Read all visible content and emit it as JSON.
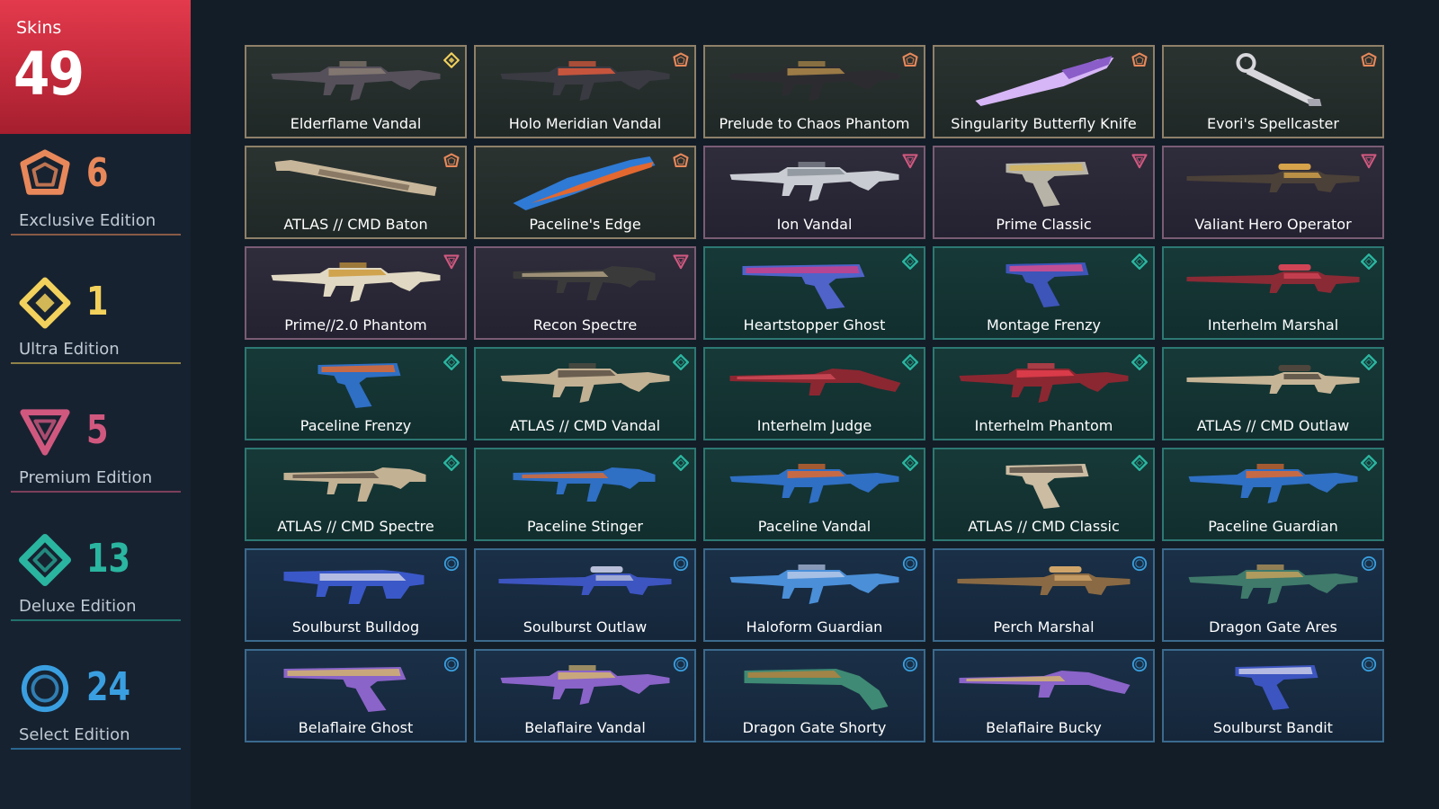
{
  "summary": {
    "label": "Skins",
    "count": "49"
  },
  "tiers": [
    {
      "key": "exclusive",
      "name": "Exclusive Edition",
      "count": "6",
      "color": "#e8885a",
      "icon": "exclusive-edition-icon"
    },
    {
      "key": "ultra",
      "name": "Ultra Edition",
      "count": "1",
      "color": "#f2d15c",
      "icon": "ultra-edition-icon"
    },
    {
      "key": "premium",
      "name": "Premium Edition",
      "count": "5",
      "color": "#d0587f",
      "icon": "premium-edition-icon"
    },
    {
      "key": "deluxe",
      "name": "Deluxe Edition",
      "count": "13",
      "color": "#2ab5a0",
      "icon": "deluxe-edition-icon"
    },
    {
      "key": "select",
      "name": "Select Edition",
      "count": "24",
      "color": "#3a9fe0",
      "icon": "select-edition-icon"
    }
  ],
  "skins": [
    {
      "name": "Elderflame Vandal",
      "tier": "ultra",
      "kind": "rifle",
      "colors": [
        "#55505a",
        "#8a7d74"
      ]
    },
    {
      "name": "Holo Meridian Vandal",
      "tier": "exclusive",
      "kind": "rifle",
      "colors": [
        "#3a3a42",
        "#e05b3c"
      ]
    },
    {
      "name": "Prelude to Chaos Phantom",
      "tier": "exclusive",
      "kind": "rifle",
      "colors": [
        "#2c2c30",
        "#b08a4a"
      ]
    },
    {
      "name": "Singularity Butterfly Knife",
      "tier": "exclusive",
      "kind": "knife",
      "colors": [
        "#d6b6f6",
        "#8a5dc9"
      ]
    },
    {
      "name": "Evori's Spellcaster",
      "tier": "exclusive",
      "kind": "wand",
      "colors": [
        "#d8d8dc",
        "#a6a6b0"
      ]
    },
    {
      "name": "ATLAS // CMD Baton",
      "tier": "exclusive",
      "kind": "baton",
      "colors": [
        "#c8b69a",
        "#7a6a58"
      ]
    },
    {
      "name": "Paceline's Edge",
      "tier": "exclusive",
      "kind": "blade",
      "colors": [
        "#2f7ad4",
        "#e3682f"
      ]
    },
    {
      "name": "Ion Vandal",
      "tier": "premium",
      "kind": "rifle",
      "colors": [
        "#c9ccd2",
        "#8b9099"
      ]
    },
    {
      "name": "Prime Classic",
      "tier": "premium",
      "kind": "pistol",
      "colors": [
        "#b7b3a7",
        "#d4b35a"
      ]
    },
    {
      "name": "Valiant Hero Operator",
      "tier": "premium",
      "kind": "sniper",
      "colors": [
        "#4b4138",
        "#d6a24a"
      ]
    },
    {
      "name": "Prime//2.0 Phantom",
      "tier": "premium",
      "kind": "rifle",
      "colors": [
        "#e0d8c2",
        "#cc9a3a"
      ]
    },
    {
      "name": "Recon Spectre",
      "tier": "premium",
      "kind": "smg",
      "colors": [
        "#3a3a3a",
        "#b6a686"
      ]
    },
    {
      "name": "Heartstopper Ghost",
      "tier": "deluxe",
      "kind": "pistol-long",
      "colors": [
        "#4f63c9",
        "#c83f8a"
      ]
    },
    {
      "name": "Montage Frenzy",
      "tier": "deluxe",
      "kind": "pistol",
      "colors": [
        "#3d55b8",
        "#d84e8c"
      ]
    },
    {
      "name": "Interhelm Marshal",
      "tier": "deluxe",
      "kind": "sniper",
      "colors": [
        "#8a2a35",
        "#d04456"
      ]
    },
    {
      "name": "Paceline Frenzy",
      "tier": "deluxe",
      "kind": "pistol",
      "colors": [
        "#2f6fc4",
        "#e06a30"
      ]
    },
    {
      "name": "ATLAS // CMD Vandal",
      "tier": "deluxe",
      "kind": "rifle",
      "colors": [
        "#c3b194",
        "#5a5044"
      ]
    },
    {
      "name": "Interhelm Judge",
      "tier": "deluxe",
      "kind": "shotgun",
      "colors": [
        "#8b2731",
        "#cf4a57"
      ]
    },
    {
      "name": "Interhelm Phantom",
      "tier": "deluxe",
      "kind": "rifle",
      "colors": [
        "#8b2731",
        "#e6404e"
      ]
    },
    {
      "name": "ATLAS // CMD Outlaw",
      "tier": "deluxe",
      "kind": "sniper",
      "colors": [
        "#c6b496",
        "#4e463c"
      ]
    },
    {
      "name": "ATLAS // CMD Spectre",
      "tier": "deluxe",
      "kind": "smg",
      "colors": [
        "#c3b194",
        "#5c5044"
      ]
    },
    {
      "name": "Paceline Stinger",
      "tier": "deluxe",
      "kind": "smg",
      "colors": [
        "#2f6fc4",
        "#e06a30"
      ]
    },
    {
      "name": "Paceline Vandal",
      "tier": "deluxe",
      "kind": "rifle",
      "colors": [
        "#2f6fc4",
        "#e06a30"
      ]
    },
    {
      "name": "ATLAS // CMD Classic",
      "tier": "deluxe",
      "kind": "pistol",
      "colors": [
        "#cbbca2",
        "#5a5046"
      ]
    },
    {
      "name": "Paceline Guardian",
      "tier": "deluxe",
      "kind": "rifle",
      "colors": [
        "#2f6fc4",
        "#e06a30"
      ]
    },
    {
      "name": "Soulburst Bulldog",
      "tier": "select",
      "kind": "bulldog",
      "colors": [
        "#3a58c8",
        "#c9cde6"
      ]
    },
    {
      "name": "Soulburst Outlaw",
      "tier": "select",
      "kind": "sniper",
      "colors": [
        "#3d55c0",
        "#b9bfd9"
      ]
    },
    {
      "name": "Haloform Guardian",
      "tier": "select",
      "kind": "rifle",
      "colors": [
        "#4a8fd8",
        "#b6c8e8"
      ]
    },
    {
      "name": "Perch Marshal",
      "tier": "select",
      "kind": "sniper",
      "colors": [
        "#8a6a44",
        "#d0a56a"
      ]
    },
    {
      "name": "Dragon Gate Ares",
      "tier": "select",
      "kind": "lmg",
      "colors": [
        "#3f7a6a",
        "#c4a15c"
      ]
    },
    {
      "name": "Belaflaire Ghost",
      "tier": "select",
      "kind": "pistol-long",
      "colors": [
        "#8a64c8",
        "#d3b370"
      ]
    },
    {
      "name": "Belaflaire Vandal",
      "tier": "select",
      "kind": "rifle",
      "colors": [
        "#8a64c8",
        "#d3b370"
      ]
    },
    {
      "name": "Dragon Gate Shorty",
      "tier": "select",
      "kind": "shorty",
      "colors": [
        "#3f8a74",
        "#b3833f"
      ]
    },
    {
      "name": "Belaflaire Bucky",
      "tier": "select",
      "kind": "shotgun",
      "colors": [
        "#8a64c8",
        "#d3b370"
      ]
    },
    {
      "name": "Soulburst Bandit",
      "tier": "select",
      "kind": "pistol",
      "colors": [
        "#3d55c0",
        "#c9cde6"
      ]
    }
  ]
}
